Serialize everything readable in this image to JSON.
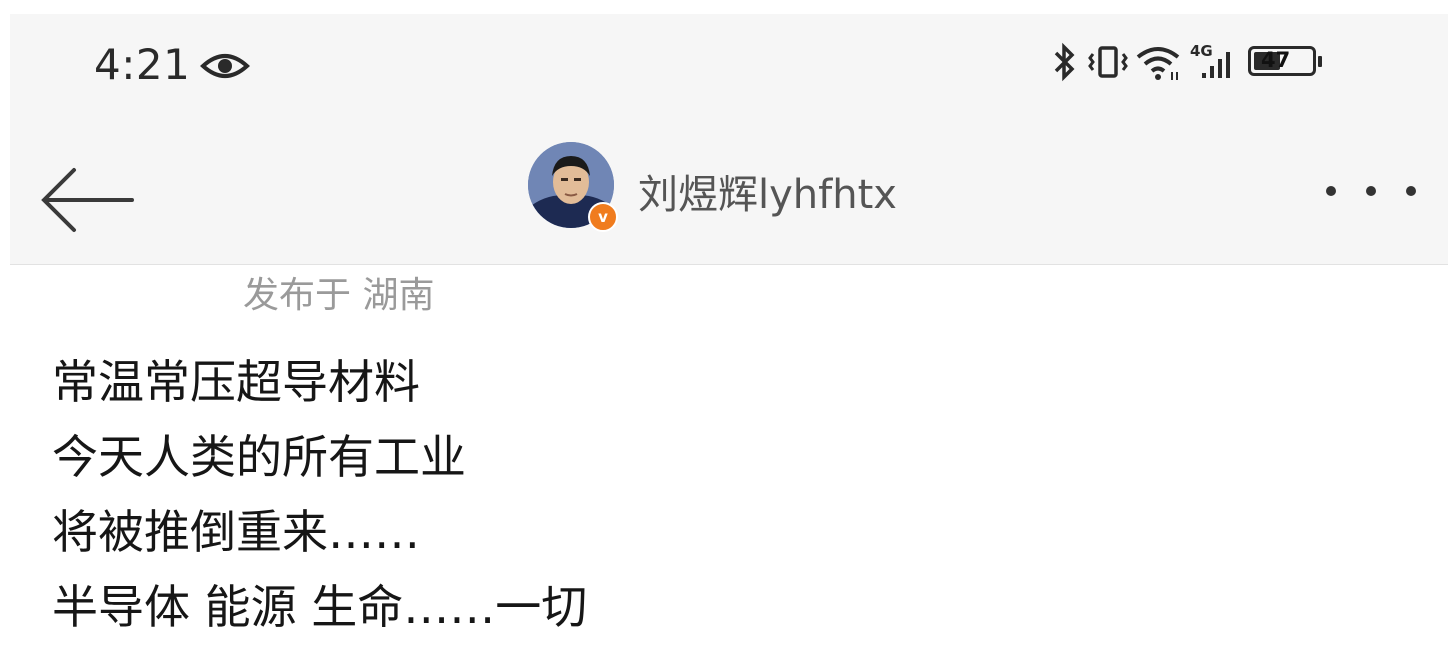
{
  "status_bar": {
    "time": "4:21",
    "battery_level": "47",
    "network_type": "4G",
    "icons": [
      "eye-icon",
      "bluetooth-icon",
      "vibrate-icon",
      "wifi-icon",
      "signal-icon",
      "battery-icon"
    ]
  },
  "header": {
    "back_icon": "arrow-left-icon",
    "username": "刘煜辉lyhfhtx",
    "verified_badge": "v",
    "more_icon": "more-dots-icon"
  },
  "post": {
    "location": "发布于 湖南",
    "lines": [
      "常温常压超导材料",
      "今天人类的所有工业",
      "将被推倒重来……",
      "半导体 能源 生命……一切"
    ]
  },
  "colors": {
    "header_bg": "#f6f6f6",
    "verified_badge": "#f07c1e",
    "location_text": "#9a9a9a"
  }
}
